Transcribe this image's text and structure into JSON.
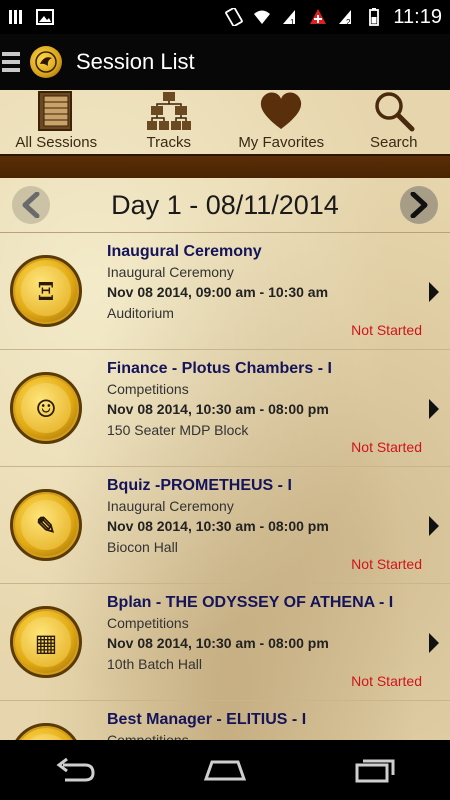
{
  "status_bar": {
    "time": "11:19",
    "icons": [
      "bars-icon",
      "image-icon",
      "rotate-icon",
      "wifi-icon",
      "sim1-icon",
      "swiss-flag-icon",
      "sim2-icon",
      "battery-icon"
    ]
  },
  "action_bar": {
    "title": "Session List"
  },
  "tabs": [
    {
      "label": "All Sessions",
      "icon": "book-icon"
    },
    {
      "label": "Tracks",
      "icon": "hierarchy-icon"
    },
    {
      "label": "My Favorites",
      "icon": "heart-icon"
    },
    {
      "label": "Search",
      "icon": "magnifier-icon"
    }
  ],
  "day_nav": {
    "title": "Day 1 - 08/11/2014"
  },
  "sessions": [
    {
      "title": "Inaugural Ceremony",
      "type": "Inaugural Ceremony",
      "time": "Nov 08 2014, 09:00 am - 10:30 am",
      "venue": "Auditorium",
      "status": "Not Started",
      "medal": "Ξ"
    },
    {
      "title": "Finance - Plotus Chambers - I",
      "type": "Competitions",
      "time": "Nov 08 2014, 10:30 am - 08:00 pm",
      "venue": "150 Seater MDP Block",
      "status": "Not Started",
      "medal": "☺"
    },
    {
      "title": "Bquiz -PROMETHEUS - I",
      "type": "Inaugural Ceremony",
      "time": "Nov 08 2014, 10:30 am - 08:00 pm",
      "venue": "Biocon Hall",
      "status": "Not Started",
      "medal": "✎"
    },
    {
      "title": "Bplan - THE ODYSSEY OF ATHENA - I",
      "type": "Competitions",
      "time": "Nov 08 2014, 10:30 am - 08:00 pm",
      "venue": "10th Batch Hall",
      "status": "Not Started",
      "medal": "▦"
    },
    {
      "title": "Best Manager - ELITIUS - I",
      "type": "Competitions",
      "time": "",
      "venue": "",
      "status": "",
      "medal": "♛"
    }
  ],
  "colors": {
    "title_blue": "#14145a",
    "status_red": "#d0141a",
    "brown_bar": "#5a2e07",
    "parchment": "#e7d6ad"
  }
}
